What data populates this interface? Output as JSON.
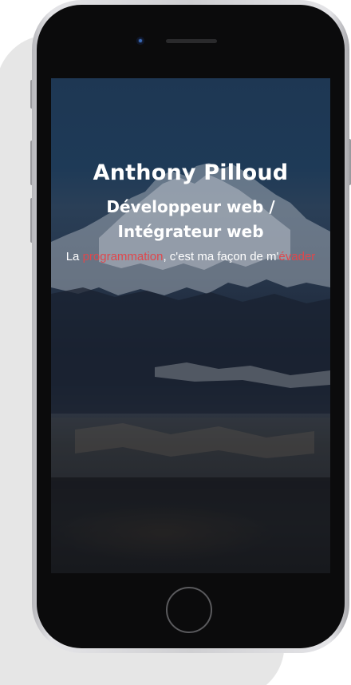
{
  "hero": {
    "name": "Anthony Pilloud",
    "role_line1": "Développeur web /",
    "role_line2": "Intégrateur web",
    "tagline": {
      "prefix": "La ",
      "highlight1": "programmation",
      "middle": ", c'est ma façon de m'",
      "highlight2": "évader"
    }
  },
  "colors": {
    "accent": "#e0474c",
    "hero_text": "#ffffff",
    "phone_bezel": "#0b0b0c",
    "phone_frame": "#cfcfd2"
  },
  "icons": {
    "front_camera": "camera-icon",
    "earpiece": "speaker-icon",
    "home": "home-button-icon"
  }
}
